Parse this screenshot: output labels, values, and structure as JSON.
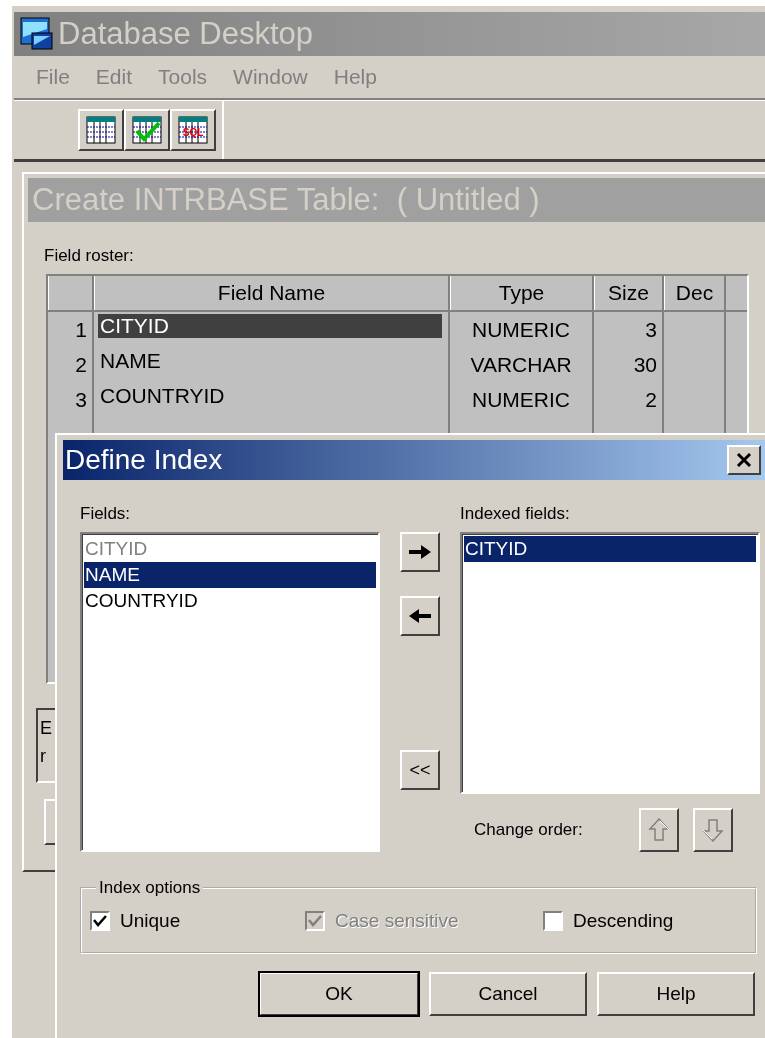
{
  "app": {
    "title": "Database Desktop",
    "menu": [
      {
        "label": "File"
      },
      {
        "label": "Edit"
      },
      {
        "label": "Tools"
      },
      {
        "label": "Window"
      },
      {
        "label": "Help"
      }
    ],
    "toolbar": [
      {
        "kind": "table"
      },
      {
        "kind": "check"
      },
      {
        "kind": "sql",
        "label": "SQL"
      }
    ]
  },
  "table_window": {
    "title": "Create INTRBASE Table:  ( Untitled )",
    "roster_label": "Field roster:",
    "columns": [
      "Field Name",
      "Type",
      "Size",
      "Dec"
    ],
    "rows": [
      {
        "number": "1",
        "field_name": "CITYID",
        "type": "NUMERIC",
        "size": "3",
        "selected": true
      },
      {
        "number": "2",
        "field_name": "NAME",
        "type": "VARCHAR",
        "size": "30",
        "selected": false
      },
      {
        "number": "3",
        "field_name": "COUNTRYID",
        "type": "NUMERIC",
        "size": "2",
        "selected": false
      }
    ],
    "hidden_text": [
      "E",
      "r"
    ]
  },
  "dialog": {
    "title": "Define Index",
    "fields_label": "Fields:",
    "fields": [
      {
        "label": "CITYID",
        "selected": false,
        "disabled": true
      },
      {
        "label": "NAME",
        "selected": true,
        "disabled": false
      },
      {
        "label": "COUNTRYID",
        "selected": false,
        "disabled": false
      }
    ],
    "add_all_label": "<<",
    "indexed_label": "Indexed fields:",
    "indexed": [
      {
        "label": "CITYID",
        "selected": true
      }
    ],
    "change_order_label": "Change order:",
    "order_buttons_disabled": true,
    "options_label": "Index options",
    "options": [
      {
        "label": "Unique",
        "checked": true,
        "disabled": false
      },
      {
        "label": "Case sensitive",
        "checked": true,
        "disabled": true
      },
      {
        "label": "Descending",
        "checked": false,
        "disabled": false
      }
    ],
    "buttons": [
      {
        "label": "OK",
        "default": true
      },
      {
        "label": "Cancel",
        "default": false
      },
      {
        "label": "Help",
        "default": false
      }
    ]
  }
}
